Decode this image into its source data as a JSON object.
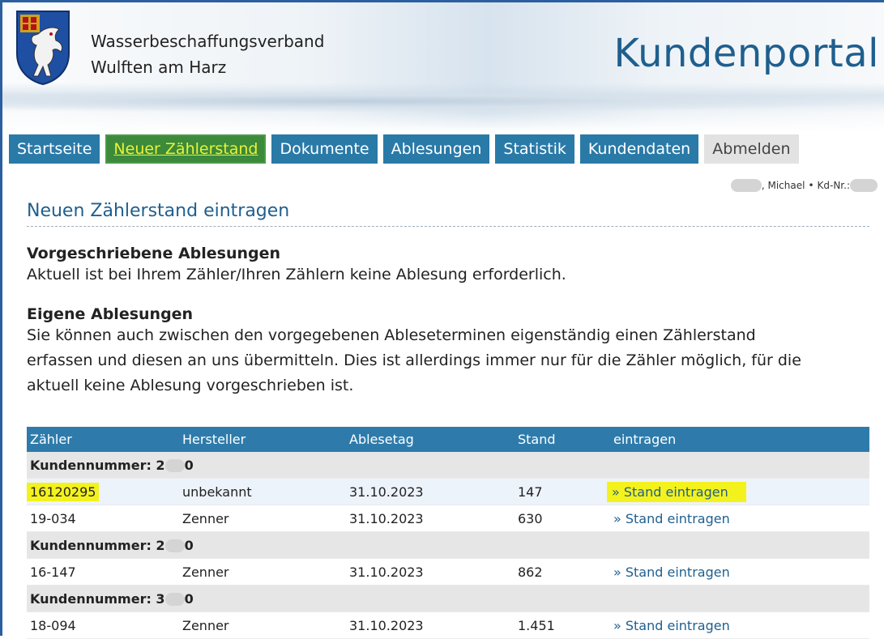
{
  "header": {
    "org_line1": "Wasserbeschaffungsverband",
    "org_line2": "Wulften am Harz",
    "portal_title": "Kundenportal"
  },
  "nav": {
    "tabs": [
      {
        "label": "Startseite"
      },
      {
        "label": "Neuer Zählerstand"
      },
      {
        "label": "Dokumente"
      },
      {
        "label": "Ablesungen"
      },
      {
        "label": "Statistik"
      },
      {
        "label": "Kundendaten"
      },
      {
        "label": "Abmelden"
      }
    ],
    "active_index": 1
  },
  "user": {
    "name_suffix": ", Michael",
    "separator": "•",
    "kd_label": "Kd-Nr.:"
  },
  "page": {
    "title": "Neuen Zählerstand eintragen",
    "section1_heading": "Vorgeschriebene Ablesungen",
    "section1_text": "Aktuell ist bei Ihrem Zähler/Ihren Zählern keine Ablesung erforderlich.",
    "section2_heading": "Eigene Ablesungen",
    "section2_text_line1": "Sie können auch zwischen den vorgegebenen Ableseterminen eigenständig einen Zählerstand",
    "section2_text_line2": "erfassen und diesen an uns übermitteln. Dies ist allerdings immer nur für die Zähler möglich, für die",
    "section2_text_line3": "aktuell keine Ablesung vorgeschrieben ist."
  },
  "table": {
    "headers": [
      "Zähler",
      "Hersteller",
      "Ablesetag",
      "Stand",
      "eintragen"
    ],
    "groups": [
      {
        "label": "Kundennummer: 2",
        "label_tail": "0",
        "rows": [
          {
            "zaehler": "16120295",
            "hersteller": "unbekannt",
            "ablesetag": "31.10.2023",
            "stand": "147",
            "action": "» Stand eintragen"
          },
          {
            "zaehler": "19-034",
            "hersteller": "Zenner",
            "ablesetag": "31.10.2023",
            "stand": "630",
            "action": "» Stand eintragen"
          }
        ]
      },
      {
        "label": "Kundennummer: 2",
        "label_tail": "0",
        "rows": [
          {
            "zaehler": "16-147",
            "hersteller": "Zenner",
            "ablesetag": "31.10.2023",
            "stand": "862",
            "action": "» Stand eintragen"
          }
        ]
      },
      {
        "label": "Kundennummer: 3",
        "label_tail": "0",
        "rows": [
          {
            "zaehler": "18-094",
            "hersteller": "Zenner",
            "ablesetag": "31.10.2023",
            "stand": "1.451",
            "action": "» Stand eintragen"
          }
        ]
      }
    ]
  },
  "colors": {
    "nav_tab": "#2a7aa8",
    "nav_active": "#3c8a3a",
    "title_blue": "#1f5f8e",
    "table_header": "#2e7bab",
    "highlight_yellow": "#f4f21c"
  },
  "icons": {
    "crest": "coat-of-arms-icon"
  }
}
